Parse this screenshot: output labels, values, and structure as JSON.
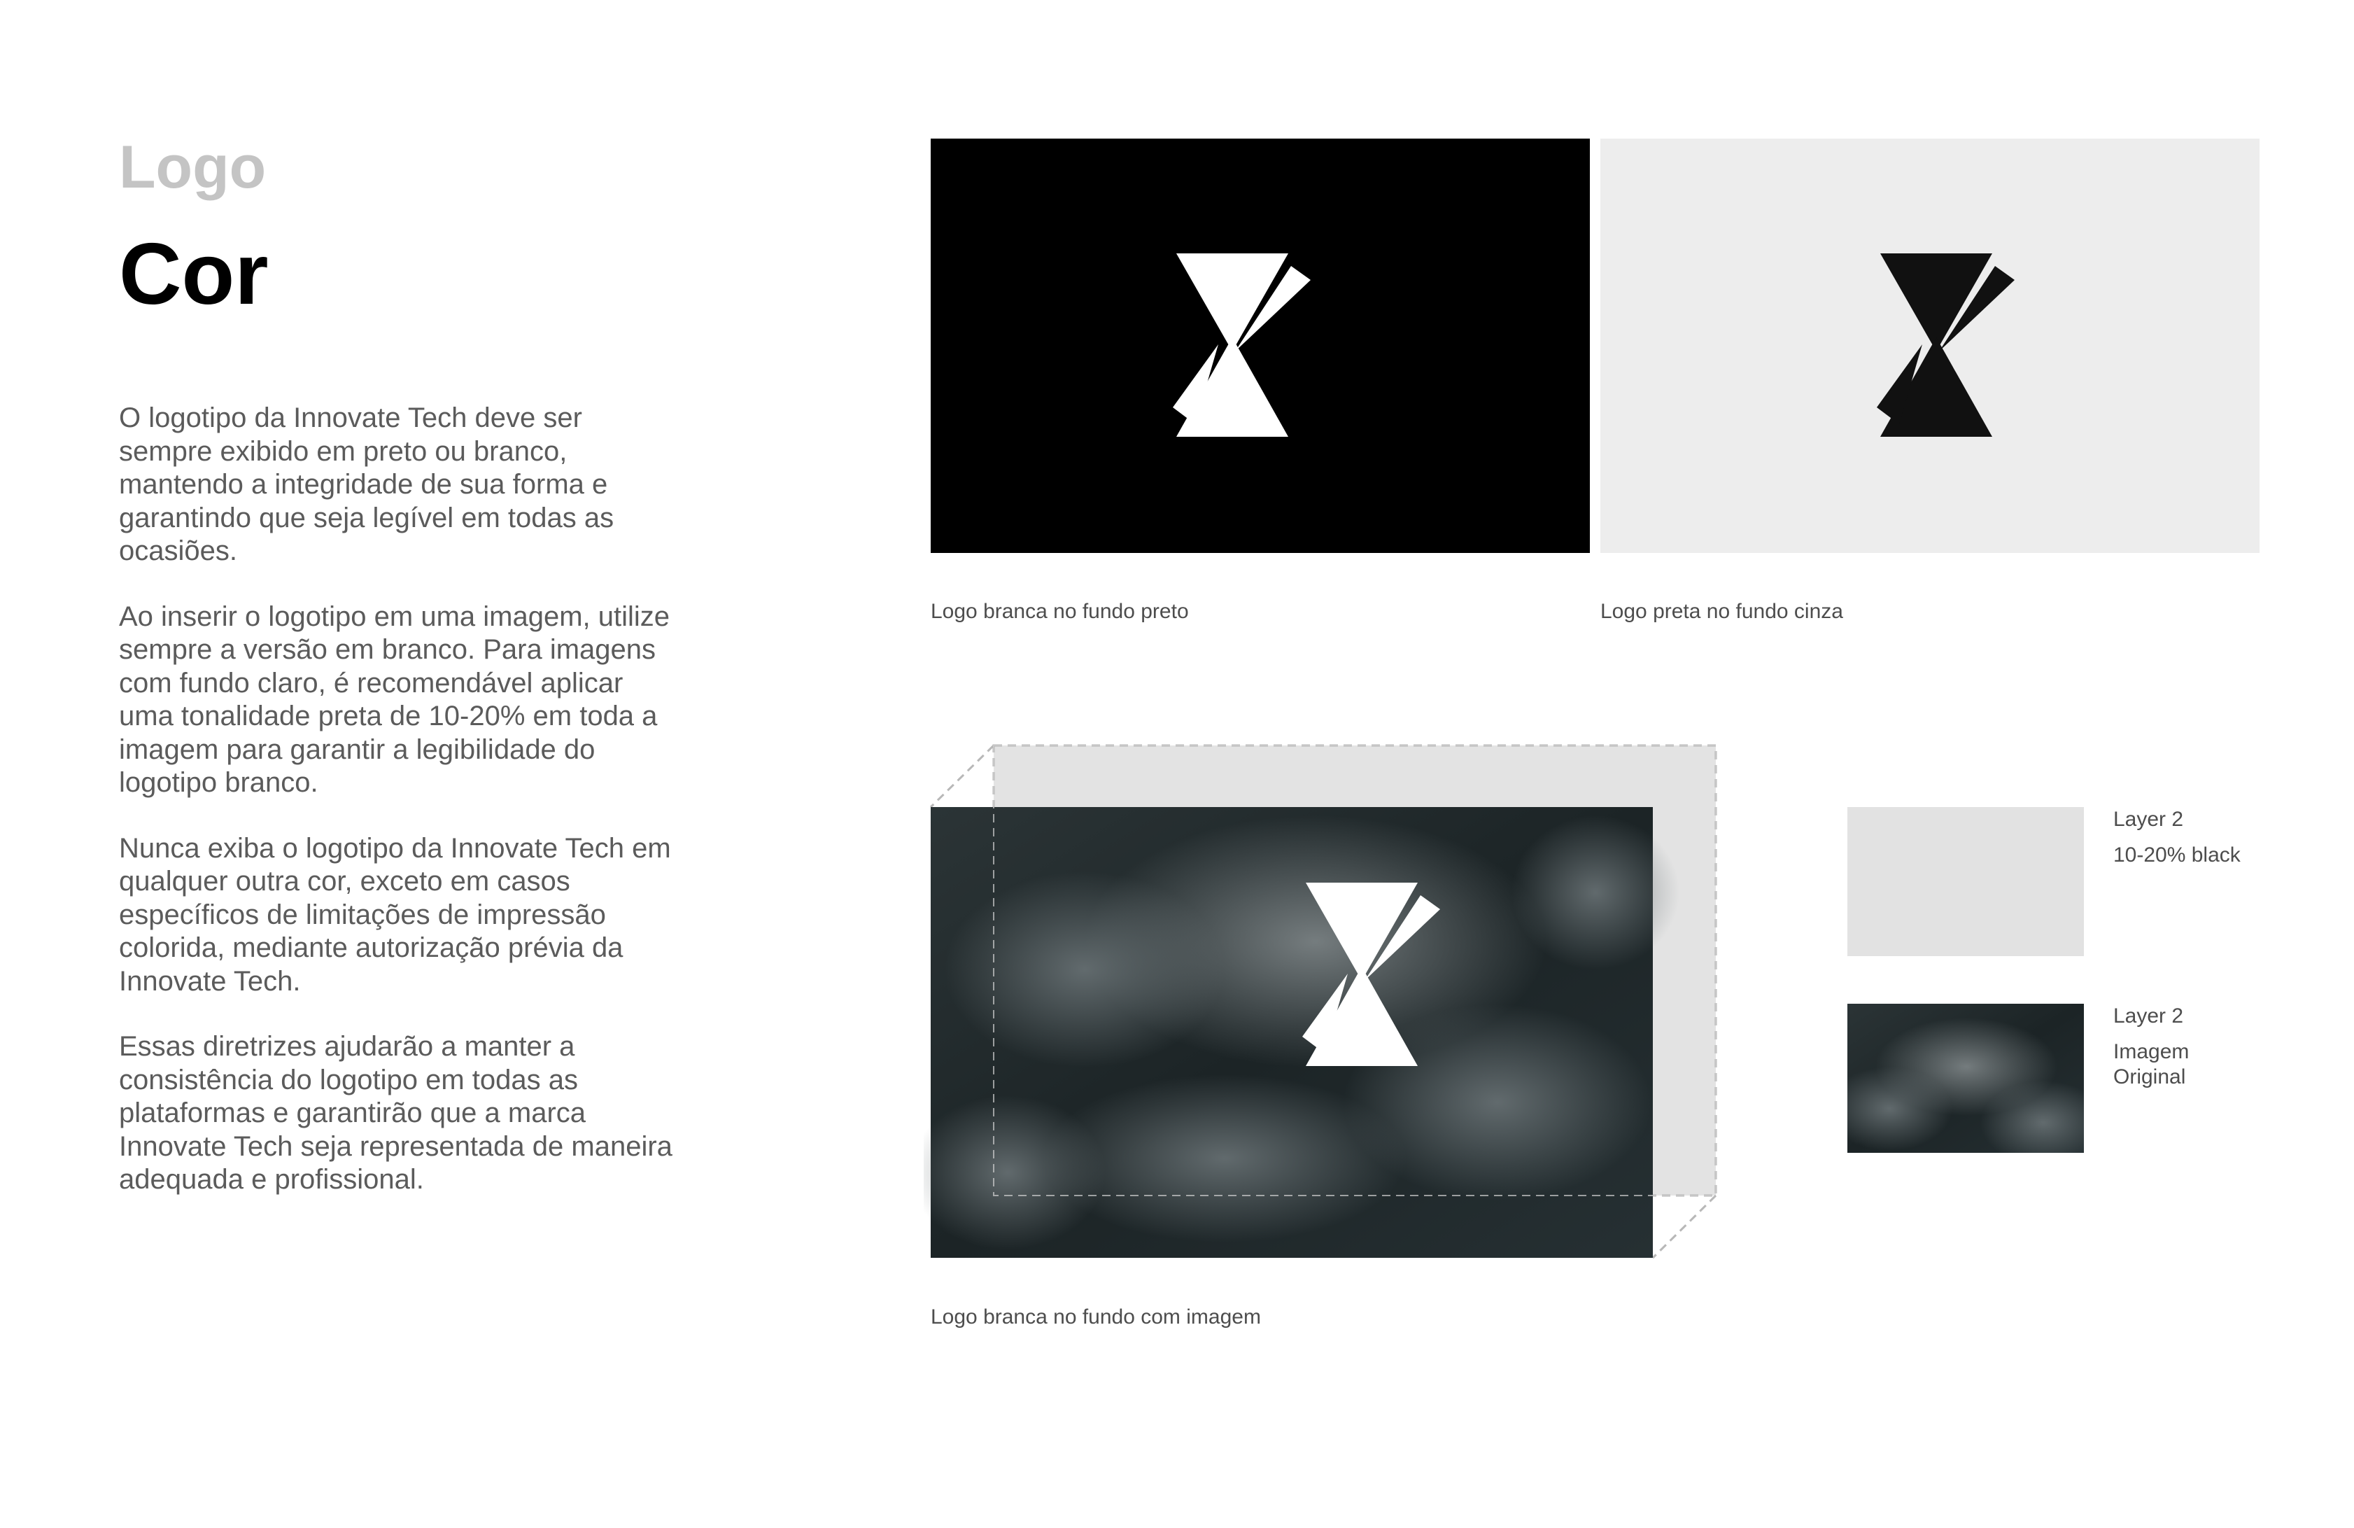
{
  "header": {
    "section_label": "Logo",
    "title": "Cor"
  },
  "body": {
    "paragraphs": [
      "O logotipo da Innovate Tech deve ser sempre exibido em preto ou branco, mantendo a integridade de sua forma e garantindo que seja legível em todas as ocasiões.",
      "Ao inserir o logotipo em uma imagem, utilize sempre a versão em branco. Para imagens com fundo claro, é recomendável aplicar uma tonalidade preta de 10-20% em toda a imagem para garantir a legibilidade do logotipo branco.",
      "Nunca exiba o logotipo da Innovate Tech em qualquer outra cor, exceto em casos específicos de limitações de impressão colorida, mediante autorização prévia da Innovate Tech.",
      "Essas diretrizes ajudarão a manter a consistência do logotipo em todas as plataformas e garantirão que a marca Innovate Tech seja representada de maneira adequada e profissional."
    ]
  },
  "panels": {
    "black": {
      "caption": "Logo branca no fundo preto",
      "background": "#000000",
      "logo_color": "#ffffff"
    },
    "gray": {
      "caption": "Logo preta no fundo cinza",
      "background": "#ededed",
      "logo_color": "#111111"
    },
    "image": {
      "caption": "Logo branca no fundo com imagem",
      "overlay_color": "#e3e3e3",
      "logo_color": "#ffffff"
    }
  },
  "layers": [
    {
      "label": "Layer 2",
      "description": "10-20% black",
      "swatch": "#e2e2e2"
    },
    {
      "label": "Layer 2",
      "description_line1": "Imagem",
      "description_line2": "Original"
    }
  ],
  "colors": {
    "heading_muted": "#c4c4c4",
    "heading": "#000000",
    "body_text": "#5b5b5b",
    "caption_text": "#4d4d4d"
  }
}
